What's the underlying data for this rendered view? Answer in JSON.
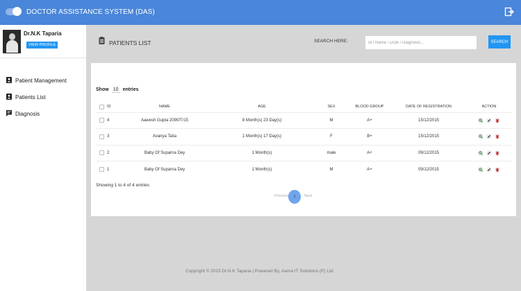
{
  "header": {
    "app_title": "DOCTOR ASSISTANCE SYSTEM (DAS)"
  },
  "profile": {
    "name": "Dr.N.K Taparia",
    "view_profile_label": "VIEW PROFILE"
  },
  "sidebar": {
    "items": [
      {
        "label": "Patient Management",
        "icon": "person-badge-icon"
      },
      {
        "label": "Patients List",
        "icon": "person-badge-icon"
      },
      {
        "label": "Diagnosis",
        "icon": "message-icon"
      }
    ]
  },
  "main": {
    "title": "PATIENTS LIST",
    "search_label": "SEARCH HERE:",
    "search_placeholder": "Id / Name / DOB / Diagnosis...",
    "search_button": "SEARCH"
  },
  "table": {
    "show_label": "Show",
    "show_count": "10",
    "entries_label": "entries",
    "columns": [
      "ID",
      "NAME",
      "AGE",
      "SEX",
      "BLOOD GROUP",
      "DATE OF REGISTRATION",
      "ACTION"
    ],
    "rows": [
      {
        "id": "4",
        "name": "Aawesh Gupta 2090/T/15",
        "age": "8 Month(s) 23 Day(s)",
        "sex": "M",
        "blood": "A+",
        "date": "15/12/2015"
      },
      {
        "id": "3",
        "name": "Avanya Tatia",
        "age": "1 Month(s) 17 Day(s)",
        "sex": "F",
        "blood": "B+",
        "date": "15/12/2015"
      },
      {
        "id": "2",
        "name": "Baby Of Suparna Dey",
        "age": "1 Month(s)",
        "sex": "male",
        "blood": "A+",
        "date": "09/12/2015"
      },
      {
        "id": "1",
        "name": "Baby Of Suparna Dey",
        "age": "1 Month(s)",
        "sex": "M",
        "blood": "A+",
        "date": "09/12/2015"
      }
    ],
    "action_icons": [
      "search-icon",
      "edit-icon",
      "delete-icon"
    ],
    "showing_text": "Showing 1 to 4 of 4 entries"
  },
  "pagination": {
    "previous": "Previous",
    "current": "1",
    "next": "Next"
  },
  "footer": {
    "text": "Copyright © 2015 Dr.N.K Taparia | Powered By, Aarna IT Solutions (P) Ltd."
  },
  "colors": {
    "topbar": "#4a86d9",
    "primary_button": "#2196f3",
    "background": "#d6d6d6"
  }
}
